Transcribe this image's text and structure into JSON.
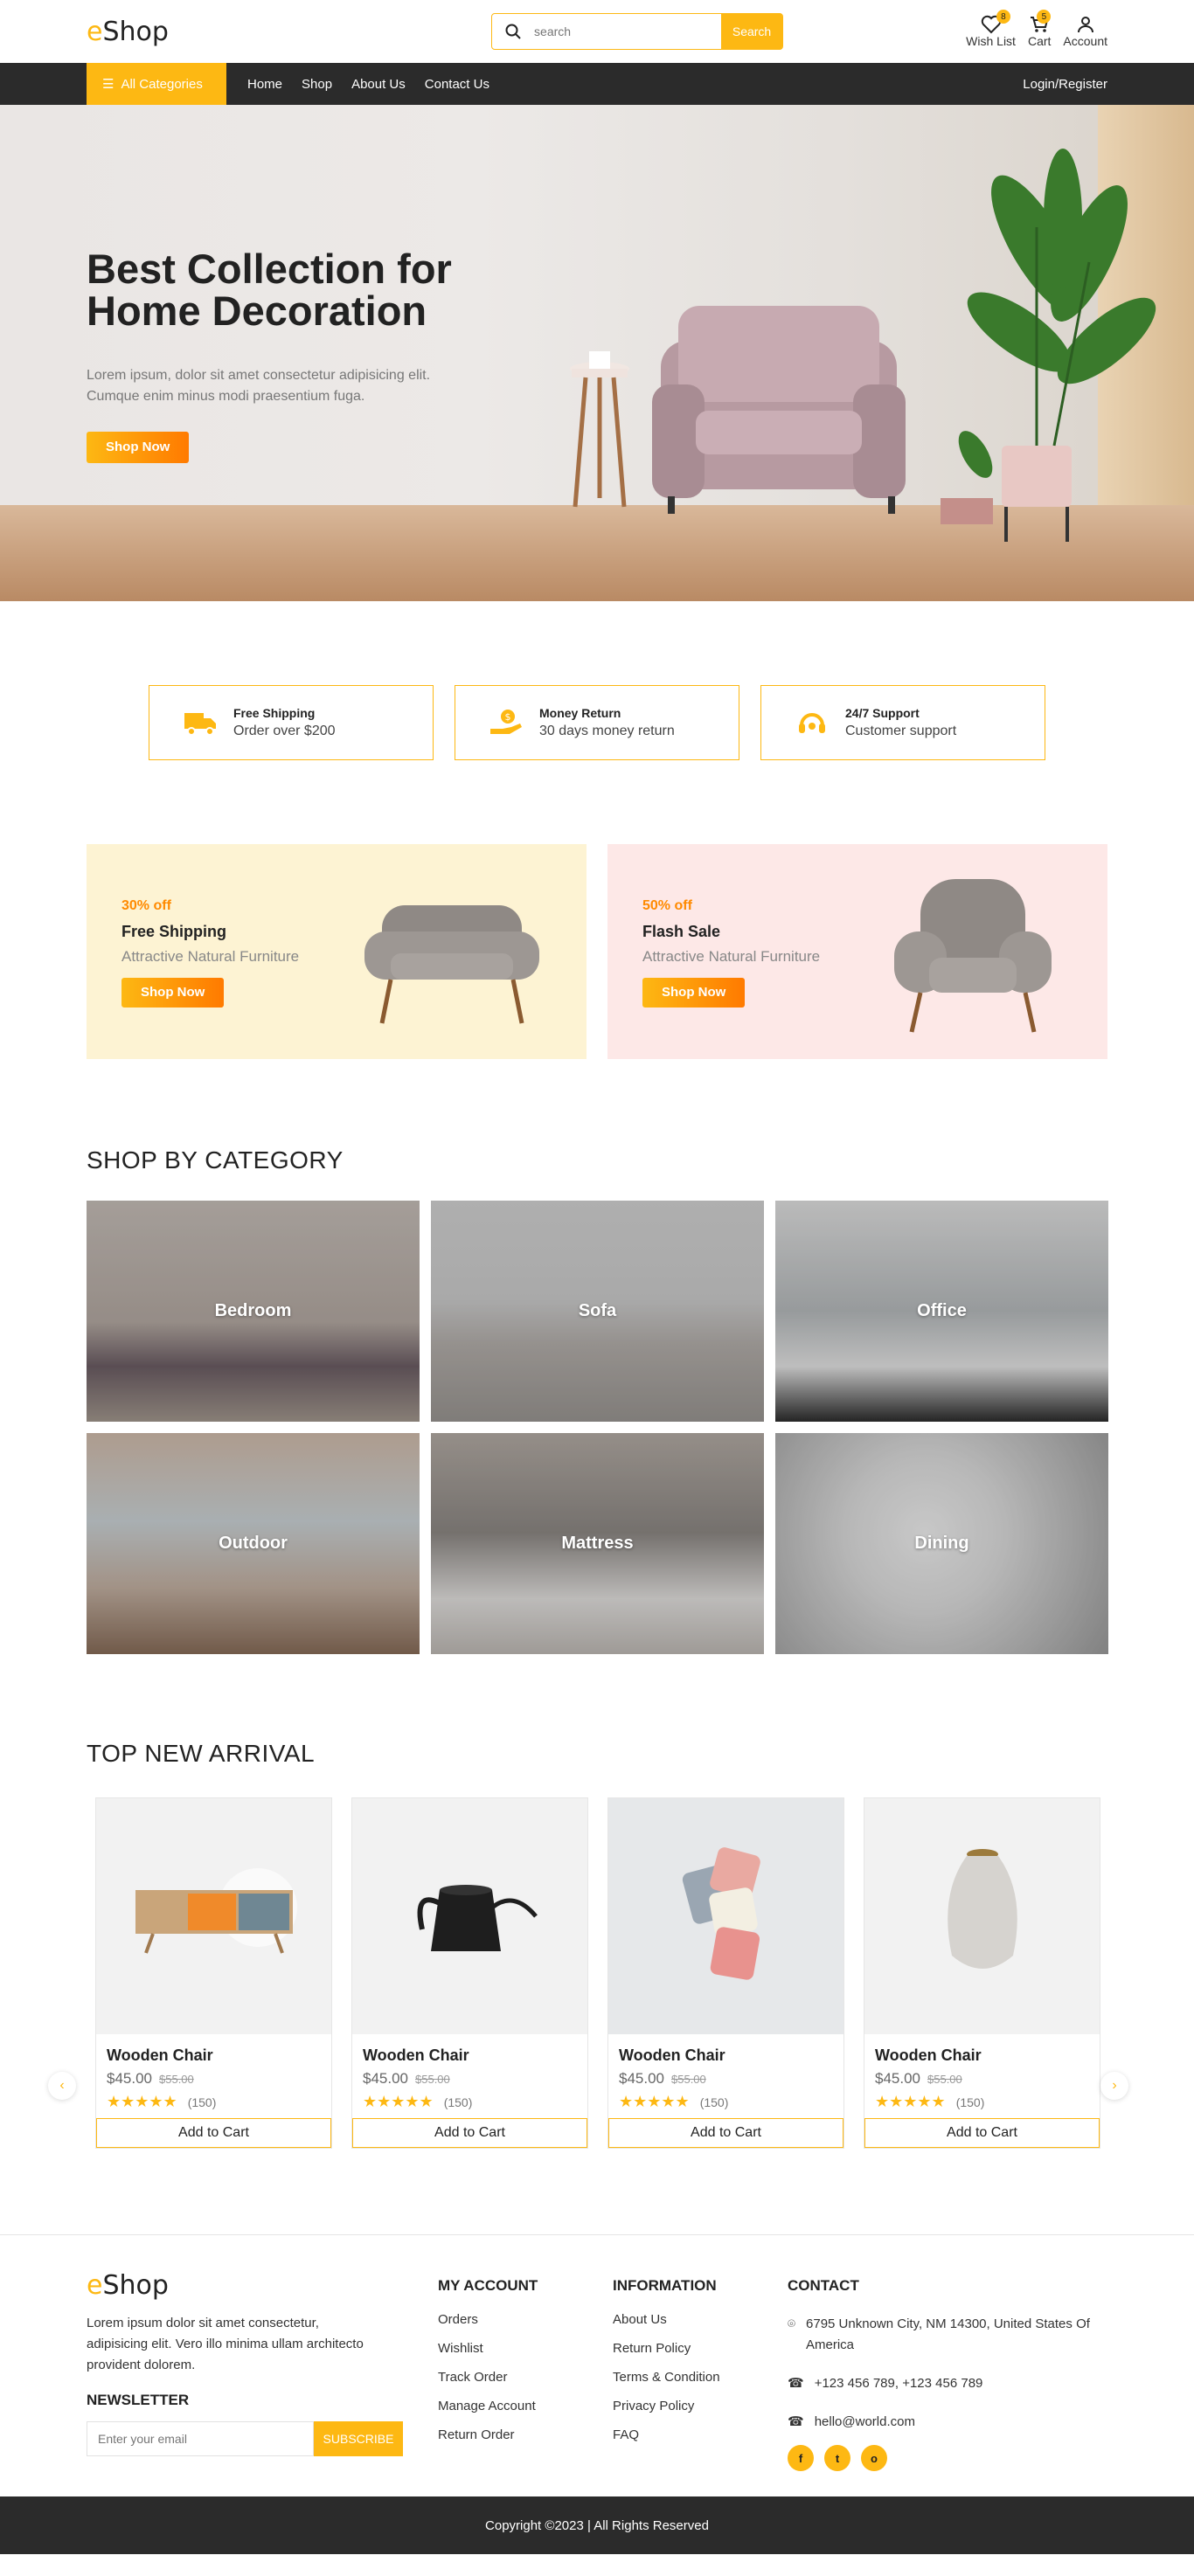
{
  "header": {
    "logo_e": "e",
    "logo_rest": "Shop",
    "search_placeholder": "search",
    "search_button": "Search",
    "wishlist_label": "Wish List",
    "wishlist_count": "8",
    "cart_label": "Cart",
    "cart_count": "5",
    "account_label": "Account"
  },
  "nav": {
    "all_categories": "All Categories",
    "items": [
      "Home",
      "Shop",
      "About Us",
      "Contact Us"
    ],
    "login": "Login/Register"
  },
  "hero": {
    "title": "Best Collection for Home Decoration",
    "text": "Lorem ipsum, dolor sit amet consectetur adipisicing elit. Cumque enim minus modi praesentium fuga.",
    "button": "Shop Now"
  },
  "features": [
    {
      "title": "Free Shipping",
      "sub": "Order over $200",
      "icon": "truck-icon"
    },
    {
      "title": "Money Return",
      "sub": "30 days money return",
      "icon": "money-hand-icon"
    },
    {
      "title": "24/7 Support",
      "sub": "Customer support",
      "icon": "headset-icon"
    }
  ],
  "promos": [
    {
      "off": "30% off",
      "title": "Free Shipping",
      "sub": "Attractive Natural Furniture",
      "button": "Shop Now",
      "bg": "#fdf3d3"
    },
    {
      "off": "50% off",
      "title": "Flash Sale",
      "sub": "Attractive Natural Furniture",
      "button": "Shop Now",
      "bg": "#fde8e7"
    }
  ],
  "categories": {
    "heading": "SHOP BY CATEGORY",
    "items": [
      "Bedroom",
      "Sofa",
      "Office",
      "Outdoor",
      "Mattress",
      "Dining"
    ]
  },
  "arrivals": {
    "heading": "TOP NEW ARRIVAL",
    "products": [
      {
        "name": "Wooden Chair",
        "price": "$45.00",
        "old": "$55.00",
        "count": "(150)",
        "button": "Add to Cart"
      },
      {
        "name": "Wooden Chair",
        "price": "$45.00",
        "old": "$55.00",
        "count": "(150)",
        "button": "Add to Cart"
      },
      {
        "name": "Wooden Chair",
        "price": "$45.00",
        "old": "$55.00",
        "count": "(150)",
        "button": "Add to Cart"
      },
      {
        "name": "Wooden Chair",
        "price": "$45.00",
        "old": "$55.00",
        "count": "(150)",
        "button": "Add to Cart"
      }
    ],
    "stars": "★★★★★"
  },
  "footer": {
    "about": "Lorem ipsum dolor sit amet consectetur, adipisicing elit. Vero illo minima ullam architecto provident dolorem.",
    "newsletter_title": "NEWSLETTER",
    "newsletter_placeholder": "Enter your email",
    "subscribe": "SUBSCRIBE",
    "account": {
      "title": "MY ACCOUNT",
      "items": [
        "Orders",
        "Wishlist",
        "Track Order",
        "Manage Account",
        "Return Order"
      ]
    },
    "info": {
      "title": "INFORMATION",
      "items": [
        "About Us",
        "Return Policy",
        "Terms & Condition",
        "Privacy Policy",
        "FAQ"
      ]
    },
    "contact": {
      "title": "CONTACT",
      "address": "6795 Unknown City, NM 14300, United States Of America",
      "phone": "+123 456 789, +123 456 789",
      "email": "hello@world.com"
    },
    "social": [
      "f",
      "t",
      "o"
    ],
    "copyright": "Copyright ©2023 | All Rights Reserved"
  },
  "colors": {
    "accent": "#fdb813",
    "dark": "#2b2b2b",
    "orange": "#ff7a00"
  }
}
